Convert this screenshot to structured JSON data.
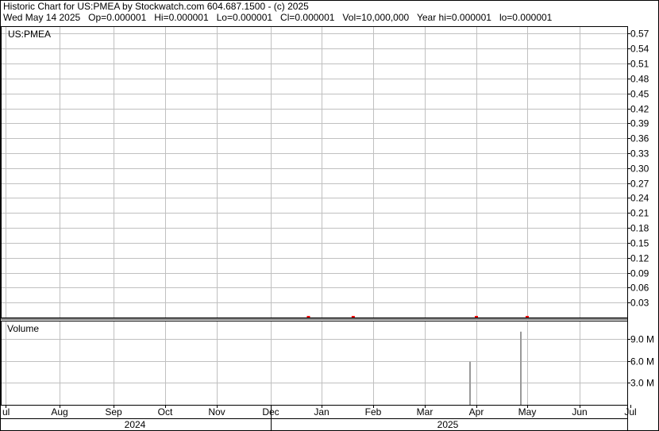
{
  "header": {
    "line1": "Historic Chart for US:PMEA by Stockwatch.com 604.687.1500 - (c) 2025",
    "line2": "Wed May 14 2025   Op=0.000001   Hi=0.000001   Lo=0.000001   Cl=0.000001   Vol=10,000,000   Year hi=0.000001   lo=0.000001"
  },
  "chart_data": [
    {
      "type": "line",
      "title": "US:PMEA",
      "ylim": [
        0,
        0.585
      ],
      "yticks": [
        "0.57",
        "0.54",
        "0.51",
        "0.48",
        "0.45",
        "0.42",
        "0.39",
        "0.36",
        "0.33",
        "0.30",
        "0.27",
        "0.24",
        "0.21",
        "0.18",
        "0.15",
        "0.12",
        "0.09",
        "0.06",
        "0.03"
      ],
      "x_months": [
        "ul",
        "Aug",
        "Sep",
        "Oct",
        "Nov",
        "Dec",
        "Jan",
        "Feb",
        "Mar",
        "Apr",
        "May",
        "Jun",
        "Jul"
      ],
      "x_years": [
        "2024",
        "2025"
      ],
      "grid": true,
      "series": [
        {
          "values": [
            {
              "x": "2024-12-24",
              "y": 1e-06
            },
            {
              "x": "2025-01-20",
              "y": 1e-06
            },
            {
              "x": "2025-04-01",
              "y": 1e-06
            },
            {
              "x": "2025-05-01",
              "y": 1e-06
            }
          ]
        }
      ],
      "colors": {
        "price_marker": "#ff0000",
        "grid": "#c0c0c0"
      }
    },
    {
      "type": "bar",
      "title": "Volume",
      "ylim": [
        0,
        11.5
      ],
      "unit": "M",
      "yticks": [
        "9.0 M",
        "6.0 M",
        "3.0 M"
      ],
      "series": [
        {
          "values": [
            {
              "x": "2025-04-01",
              "y": 5.9
            },
            {
              "x": "2025-05-01",
              "y": 10.0
            }
          ]
        }
      ],
      "colors": {
        "volume_bar": "#999999"
      }
    }
  ]
}
